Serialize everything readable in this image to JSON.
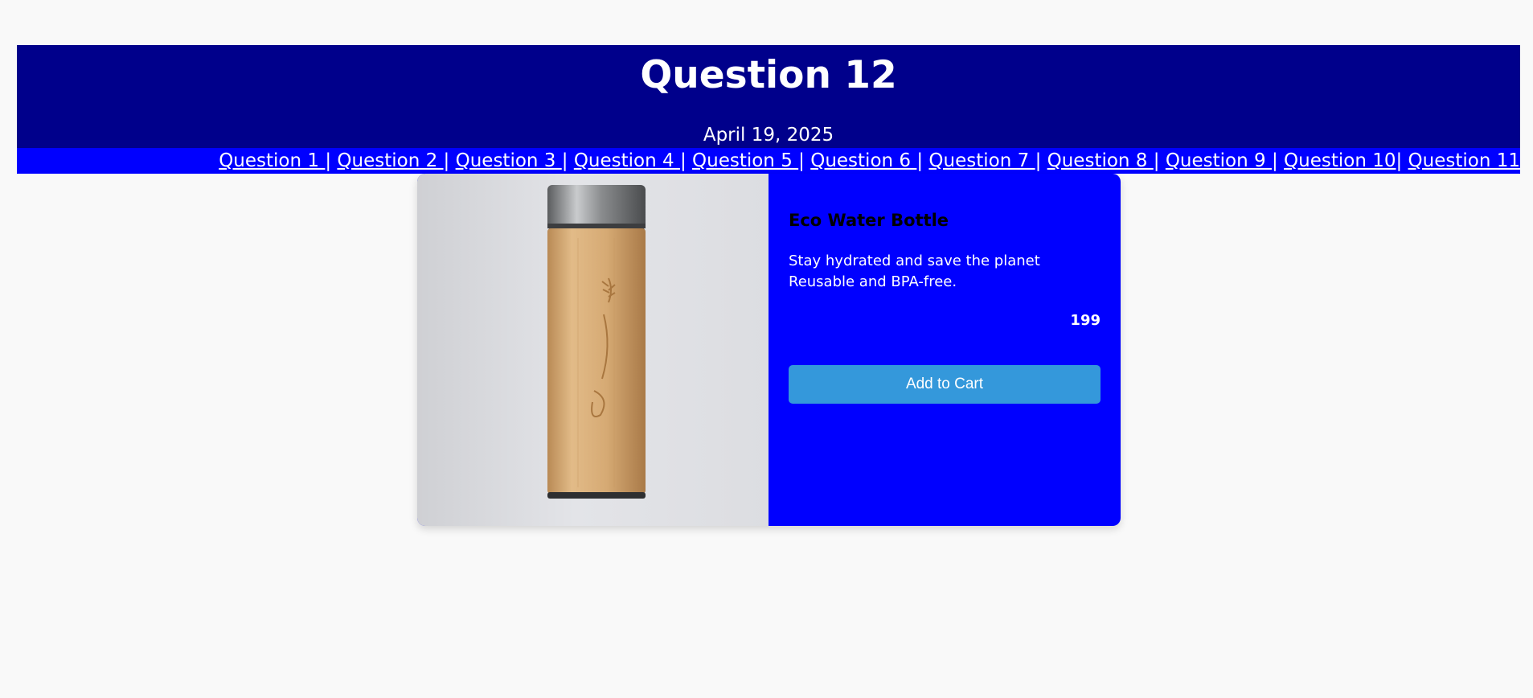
{
  "header": {
    "title": "Question 12",
    "date": "April 19, 2025"
  },
  "nav": {
    "items": [
      {
        "label": "Question 1 ",
        "sep": "| "
      },
      {
        "label": "Question 2 ",
        "sep": "| "
      },
      {
        "label": "Question 3 ",
        "sep": "| "
      },
      {
        "label": "Question 4 ",
        "sep": "| "
      },
      {
        "label": "Question 5 ",
        "sep": "| "
      },
      {
        "label": "Question 6 ",
        "sep": "| "
      },
      {
        "label": "Question 7 ",
        "sep": "| "
      },
      {
        "label": "Question 8 ",
        "sep": "| "
      },
      {
        "label": "Question 9 ",
        "sep": "| "
      },
      {
        "label": "Question 10",
        "sep": "| "
      },
      {
        "label": "Question 11",
        "sep": ""
      }
    ]
  },
  "product": {
    "image_icon": "bamboo-water-bottle-image",
    "title": "Eco Water Bottle",
    "description": "Stay hydrated and save the planet Reusable and BPA-free.",
    "price": "199",
    "add_to_cart_label": "Add to Cart"
  },
  "colors": {
    "header_bg": "#00008b",
    "nav_bg": "#0000ff",
    "card_bg": "#0000ff",
    "button_bg": "#3498db",
    "page_bg": "#f9f9f9"
  }
}
